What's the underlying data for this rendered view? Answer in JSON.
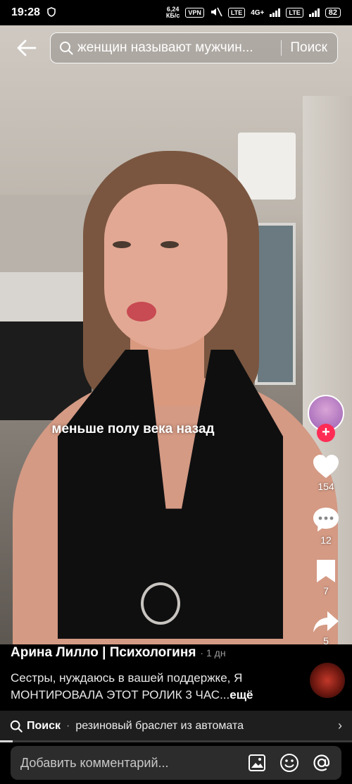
{
  "status_bar": {
    "time": "19:28",
    "net_speed_value": "6,24",
    "net_speed_unit": "КБ/с",
    "vpn": "VPN",
    "lte1": "LTE",
    "lte2": "LTE",
    "network_4g": "4G+",
    "battery": "82"
  },
  "search": {
    "query": "женщин называют мужчин...",
    "button_label": "Поиск"
  },
  "video": {
    "caption": "меньше полу века назад"
  },
  "actions": {
    "likes": "154",
    "comments": "12",
    "bookmarks": "7",
    "shares": "5",
    "follow_symbol": "+"
  },
  "post": {
    "author": "Арина Лилло | Психологиня",
    "age": "· 1 дн",
    "description": "Сестры, нуждаюсь в вашей поддержке, Я МОНТИРОВАЛА ЭТОТ РОЛИК 3 ЧАС...",
    "more_label": "ещё"
  },
  "related_search": {
    "label": "Поиск",
    "separator": "·",
    "term": "резиновый браслет из автомата",
    "chevron": "›"
  },
  "playback": {
    "progress": 0.035
  },
  "comment": {
    "placeholder": "Добавить комментарий..."
  },
  "colors": {
    "accent": "#fe2c55",
    "bar_bg": "#1e1e1e",
    "input_bg": "#2c2c2c"
  }
}
